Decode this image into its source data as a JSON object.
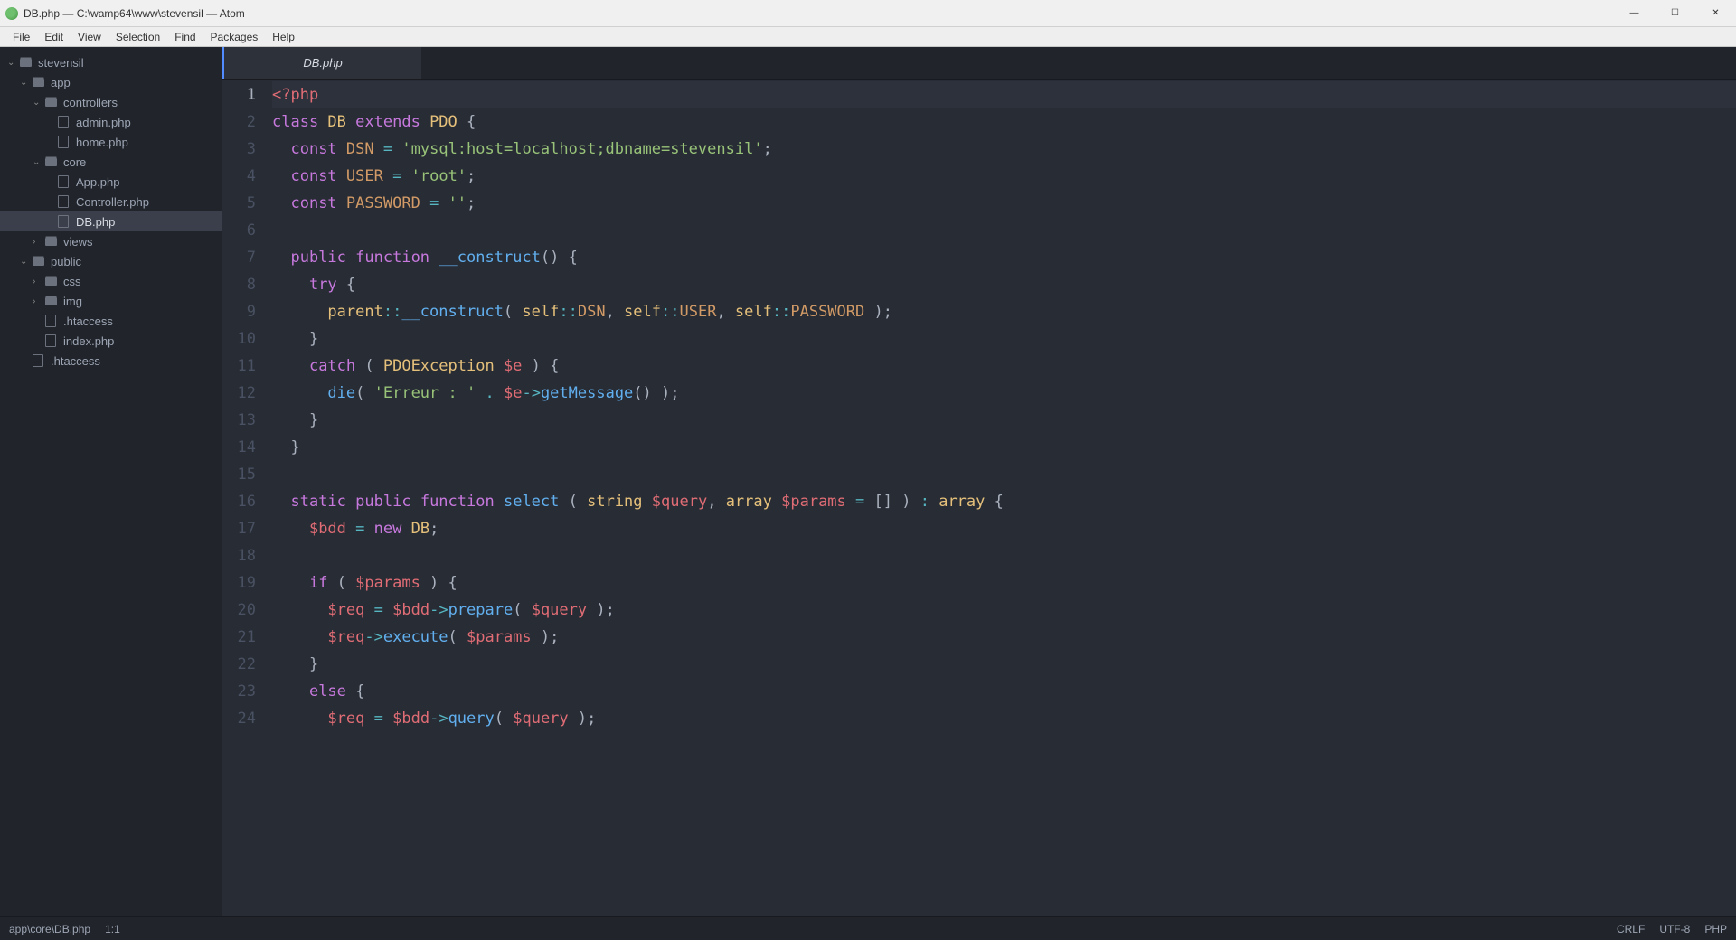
{
  "window": {
    "title": "DB.php — C:\\wamp64\\www\\stevensil — Atom"
  },
  "menu": {
    "items": [
      "File",
      "Edit",
      "View",
      "Selection",
      "Find",
      "Packages",
      "Help"
    ]
  },
  "tree": {
    "root": "stevensil",
    "nodes": [
      {
        "depth": 0,
        "type": "folder",
        "name": "stevensil",
        "open": true
      },
      {
        "depth": 1,
        "type": "folder",
        "name": "app",
        "open": true
      },
      {
        "depth": 2,
        "type": "folder",
        "name": "controllers",
        "open": true
      },
      {
        "depth": 3,
        "type": "file",
        "name": "admin.php"
      },
      {
        "depth": 3,
        "type": "file",
        "name": "home.php"
      },
      {
        "depth": 2,
        "type": "folder",
        "name": "core",
        "open": true
      },
      {
        "depth": 3,
        "type": "file",
        "name": "App.php"
      },
      {
        "depth": 3,
        "type": "file",
        "name": "Controller.php"
      },
      {
        "depth": 3,
        "type": "file",
        "name": "DB.php",
        "selected": true
      },
      {
        "depth": 2,
        "type": "folder",
        "name": "views",
        "open": false
      },
      {
        "depth": 1,
        "type": "folder",
        "name": "public",
        "open": true
      },
      {
        "depth": 2,
        "type": "folder",
        "name": "css",
        "open": false
      },
      {
        "depth": 2,
        "type": "folder",
        "name": "img",
        "open": false
      },
      {
        "depth": 2,
        "type": "file",
        "name": ".htaccess"
      },
      {
        "depth": 2,
        "type": "file",
        "name": "index.php"
      },
      {
        "depth": 1,
        "type": "file",
        "name": ".htaccess"
      }
    ]
  },
  "tabs": {
    "active": "DB.php"
  },
  "editor": {
    "active_line": 1,
    "lines": [
      [
        [
          "c-tag",
          "<?php"
        ]
      ],
      [
        [
          "c-kw",
          "class "
        ],
        [
          "c-cls",
          "DB"
        ],
        [
          "c-pun",
          " "
        ],
        [
          "c-kw",
          "extends"
        ],
        [
          "c-pun",
          " "
        ],
        [
          "c-cls",
          "PDO"
        ],
        [
          "c-pun",
          " {"
        ]
      ],
      [
        [
          "c-pun",
          "  "
        ],
        [
          "c-kw",
          "const"
        ],
        [
          "c-pun",
          " "
        ],
        [
          "c-const",
          "DSN"
        ],
        [
          "c-pun",
          " "
        ],
        [
          "c-op",
          "="
        ],
        [
          "c-pun",
          " "
        ],
        [
          "c-str",
          "'mysql:host=localhost;dbname=stevensil'"
        ],
        [
          "c-pun",
          ";"
        ]
      ],
      [
        [
          "c-pun",
          "  "
        ],
        [
          "c-kw",
          "const"
        ],
        [
          "c-pun",
          " "
        ],
        [
          "c-const",
          "USER"
        ],
        [
          "c-pun",
          " "
        ],
        [
          "c-op",
          "="
        ],
        [
          "c-pun",
          " "
        ],
        [
          "c-str",
          "'root'"
        ],
        [
          "c-pun",
          ";"
        ]
      ],
      [
        [
          "c-pun",
          "  "
        ],
        [
          "c-kw",
          "const"
        ],
        [
          "c-pun",
          " "
        ],
        [
          "c-const",
          "PASSWORD"
        ],
        [
          "c-pun",
          " "
        ],
        [
          "c-op",
          "="
        ],
        [
          "c-pun",
          " "
        ],
        [
          "c-str",
          "''"
        ],
        [
          "c-pun",
          ";"
        ]
      ],
      [],
      [
        [
          "c-pun",
          "  "
        ],
        [
          "c-kw",
          "public"
        ],
        [
          "c-pun",
          " "
        ],
        [
          "c-kw",
          "function"
        ],
        [
          "c-pun",
          " "
        ],
        [
          "c-fn",
          "__construct"
        ],
        [
          "c-pun",
          "() {"
        ]
      ],
      [
        [
          "c-pun",
          "    "
        ],
        [
          "c-kw",
          "try"
        ],
        [
          "c-pun",
          " {"
        ]
      ],
      [
        [
          "c-pun",
          "      "
        ],
        [
          "c-self",
          "parent"
        ],
        [
          "c-op",
          "::"
        ],
        [
          "c-fn",
          "__construct"
        ],
        [
          "c-pun",
          "( "
        ],
        [
          "c-self",
          "self"
        ],
        [
          "c-op",
          "::"
        ],
        [
          "c-const",
          "DSN"
        ],
        [
          "c-pun",
          ", "
        ],
        [
          "c-self",
          "self"
        ],
        [
          "c-op",
          "::"
        ],
        [
          "c-const",
          "USER"
        ],
        [
          "c-pun",
          ", "
        ],
        [
          "c-self",
          "self"
        ],
        [
          "c-op",
          "::"
        ],
        [
          "c-const",
          "PASSWORD"
        ],
        [
          "c-pun",
          " );"
        ]
      ],
      [
        [
          "c-pun",
          "    }"
        ]
      ],
      [
        [
          "c-pun",
          "    "
        ],
        [
          "c-kw",
          "catch"
        ],
        [
          "c-pun",
          " ( "
        ],
        [
          "c-cls",
          "PDOException"
        ],
        [
          "c-pun",
          " "
        ],
        [
          "c-var",
          "$e"
        ],
        [
          "c-pun",
          " ) {"
        ]
      ],
      [
        [
          "c-pun",
          "      "
        ],
        [
          "c-fn",
          "die"
        ],
        [
          "c-pun",
          "( "
        ],
        [
          "c-str",
          "'Erreur : '"
        ],
        [
          "c-pun",
          " "
        ],
        [
          "c-op",
          "."
        ],
        [
          "c-pun",
          " "
        ],
        [
          "c-var",
          "$e"
        ],
        [
          "c-op",
          "->"
        ],
        [
          "c-fn",
          "getMessage"
        ],
        [
          "c-pun",
          "() );"
        ]
      ],
      [
        [
          "c-pun",
          "    }"
        ]
      ],
      [
        [
          "c-pun",
          "  }"
        ]
      ],
      [],
      [
        [
          "c-pun",
          "  "
        ],
        [
          "c-kw",
          "static"
        ],
        [
          "c-pun",
          " "
        ],
        [
          "c-kw",
          "public"
        ],
        [
          "c-pun",
          " "
        ],
        [
          "c-kw",
          "function"
        ],
        [
          "c-pun",
          " "
        ],
        [
          "c-fn",
          "select"
        ],
        [
          "c-pun",
          " ( "
        ],
        [
          "c-cls",
          "string"
        ],
        [
          "c-pun",
          " "
        ],
        [
          "c-var",
          "$query"
        ],
        [
          "c-pun",
          ", "
        ],
        [
          "c-cls",
          "array"
        ],
        [
          "c-pun",
          " "
        ],
        [
          "c-var",
          "$params"
        ],
        [
          "c-pun",
          " "
        ],
        [
          "c-op",
          "="
        ],
        [
          "c-pun",
          " [] ) "
        ],
        [
          "c-op",
          ":"
        ],
        [
          "c-pun",
          " "
        ],
        [
          "c-cls",
          "array"
        ],
        [
          "c-pun",
          " {"
        ]
      ],
      [
        [
          "c-pun",
          "    "
        ],
        [
          "c-var",
          "$bdd"
        ],
        [
          "c-pun",
          " "
        ],
        [
          "c-op",
          "="
        ],
        [
          "c-pun",
          " "
        ],
        [
          "c-kw",
          "new"
        ],
        [
          "c-pun",
          " "
        ],
        [
          "c-cls",
          "DB"
        ],
        [
          "c-pun",
          ";"
        ]
      ],
      [],
      [
        [
          "c-pun",
          "    "
        ],
        [
          "c-kw",
          "if"
        ],
        [
          "c-pun",
          " ( "
        ],
        [
          "c-var",
          "$params"
        ],
        [
          "c-pun",
          " ) {"
        ]
      ],
      [
        [
          "c-pun",
          "      "
        ],
        [
          "c-var",
          "$req"
        ],
        [
          "c-pun",
          " "
        ],
        [
          "c-op",
          "="
        ],
        [
          "c-pun",
          " "
        ],
        [
          "c-var",
          "$bdd"
        ],
        [
          "c-op",
          "->"
        ],
        [
          "c-fn",
          "prepare"
        ],
        [
          "c-pun",
          "( "
        ],
        [
          "c-var",
          "$query"
        ],
        [
          "c-pun",
          " );"
        ]
      ],
      [
        [
          "c-pun",
          "      "
        ],
        [
          "c-var",
          "$req"
        ],
        [
          "c-op",
          "->"
        ],
        [
          "c-fn",
          "execute"
        ],
        [
          "c-pun",
          "( "
        ],
        [
          "c-var",
          "$params"
        ],
        [
          "c-pun",
          " );"
        ]
      ],
      [
        [
          "c-pun",
          "    }"
        ]
      ],
      [
        [
          "c-pun",
          "    "
        ],
        [
          "c-kw",
          "else"
        ],
        [
          "c-pun",
          " {"
        ]
      ],
      [
        [
          "c-pun",
          "      "
        ],
        [
          "c-var",
          "$req"
        ],
        [
          "c-pun",
          " "
        ],
        [
          "c-op",
          "="
        ],
        [
          "c-pun",
          " "
        ],
        [
          "c-var",
          "$bdd"
        ],
        [
          "c-op",
          "->"
        ],
        [
          "c-fn",
          "query"
        ],
        [
          "c-pun",
          "( "
        ],
        [
          "c-var",
          "$query"
        ],
        [
          "c-pun",
          " );"
        ]
      ]
    ]
  },
  "status": {
    "path": "app\\core\\DB.php",
    "cursor": "1:1",
    "line_ending": "CRLF",
    "encoding": "UTF-8",
    "language": "PHP"
  }
}
